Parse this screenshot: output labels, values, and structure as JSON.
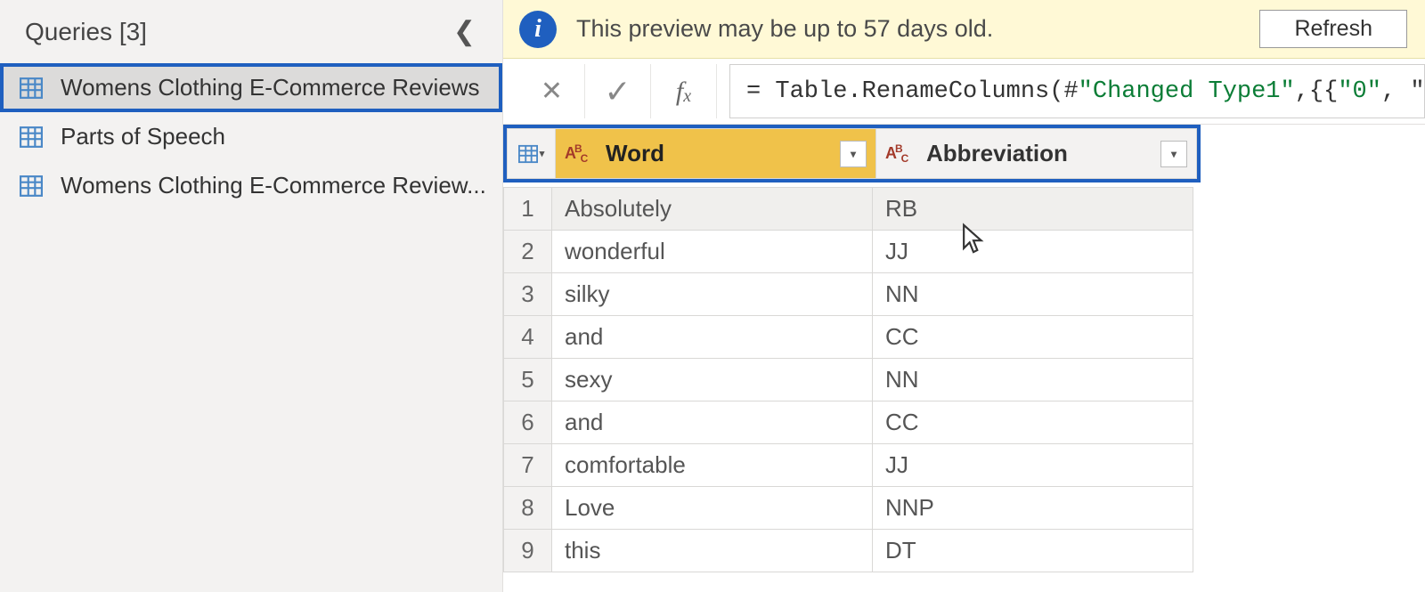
{
  "sidebar": {
    "title": "Queries [3]",
    "items": [
      {
        "label": "Womens Clothing E-Commerce Reviews",
        "selected": true
      },
      {
        "label": "Parts of Speech",
        "selected": false
      },
      {
        "label": "Womens Clothing E-Commerce Review...",
        "selected": false
      }
    ]
  },
  "notification": {
    "text": "This preview may be up to 57 days old.",
    "refresh_label": "Refresh"
  },
  "formula": {
    "prefix": "= Table.RenameColumns(#",
    "arg_str": "\"Changed Type1\"",
    "mid": ",{{",
    "arg_str2": "\"0\"",
    "tail": ", \""
  },
  "columns": [
    {
      "name": "Word",
      "type_label": "ABC",
      "highlight": true
    },
    {
      "name": "Abbreviation",
      "type_label": "ABC",
      "highlight": false
    }
  ],
  "rows": [
    {
      "n": "1",
      "word": "Absolutely",
      "abbr": "RB"
    },
    {
      "n": "2",
      "word": "wonderful",
      "abbr": "JJ"
    },
    {
      "n": "3",
      "word": "silky",
      "abbr": "NN"
    },
    {
      "n": "4",
      "word": "and",
      "abbr": "CC"
    },
    {
      "n": "5",
      "word": "sexy",
      "abbr": "NN"
    },
    {
      "n": "6",
      "word": "and",
      "abbr": "CC"
    },
    {
      "n": "7",
      "word": "comfortable",
      "abbr": "JJ"
    },
    {
      "n": "8",
      "word": "Love",
      "abbr": "NNP"
    },
    {
      "n": "9",
      "word": "this",
      "abbr": "DT"
    }
  ]
}
